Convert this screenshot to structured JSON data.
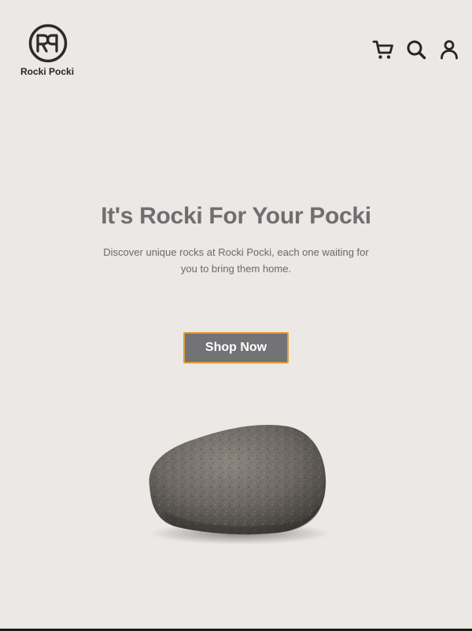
{
  "brand": {
    "logo_monogram": "RP",
    "name": "Rocki Pocki"
  },
  "nav": {
    "icons": [
      "cart-icon",
      "search-icon",
      "user-icon"
    ]
  },
  "hero": {
    "title": "It's Rocki For Your Pocki",
    "subtitle": "Discover unique rocks at Rocki Pocki, each one waiting for you to bring them home.",
    "cta_label": "Shop Now"
  },
  "colors": {
    "background": "#ebe8e5",
    "title_gray": "#6f6e70",
    "button_bg": "#737275",
    "button_border": "#e0a13a",
    "icon_dark": "#262626"
  }
}
